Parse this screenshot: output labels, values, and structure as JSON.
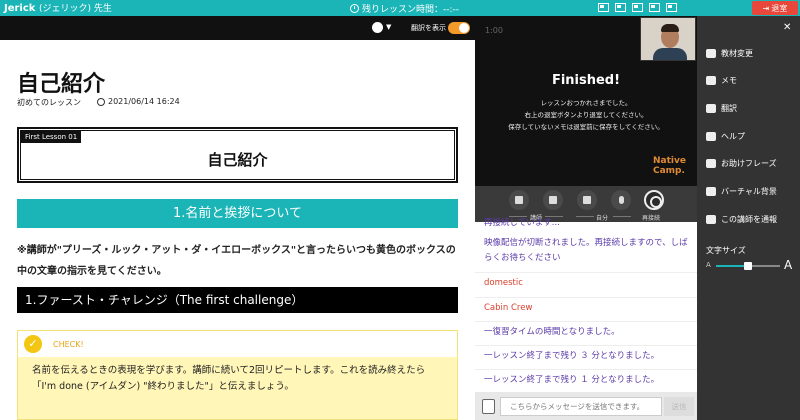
{
  "colors": {
    "accent": "#1bb5b8",
    "exit": "#e8473b",
    "toggle": "#f39a2a",
    "sidebar_bg": "#333333",
    "check_yellow": "#f3c614"
  },
  "topbar": {
    "teacher_name": "Jerick",
    "teacher_sub": "(ジェリック) 先生",
    "timer_label": "残りレッスン時間：--:--",
    "exit_label": "退室"
  },
  "material": {
    "translate_label": "翻訳を表示",
    "title": "自己紹介",
    "course": "初めてのレッスン",
    "date": "2021/06/14 16:24",
    "lesson_tag": "First Lesson 01",
    "lesson_heading": "自己紹介",
    "section1": "1.名前と挨拶について",
    "instruction": "※講師が\"プリーズ・ルック・アット・ダ・イエローボックス\"と言ったらいつも黄色のボックスの中の文章の指示を見てください。",
    "section2": "1.ファースト・チャレンジ（The first challenge）",
    "check_label": "CHECK!",
    "check_body_1": "名前を伝えるときの表現を学びます。講師に続いて2回リピートします。これを読み終えたら",
    "check_body_2": "「I'm done (アイムダン) \"終わりました\"」と伝えましょう。"
  },
  "video": {
    "clock": "1:00",
    "finished_title": "Finished!",
    "line1": "レッスンおつかれさまでした。",
    "line2": "右上の退室ボタンより退室してください。",
    "line3": "保存していないメモは退室前に保存をしてください。",
    "logo_line1": "Native",
    "logo_line2": "Camp.",
    "ctrl_teacher": "講師",
    "ctrl_self": "自分",
    "ctrl_reconnect": "再接続"
  },
  "chat": {
    "partial": "再接続しています...",
    "messages": [
      {
        "text": "映像配信が切断されました。再接続しますので、しばらくお待ちください",
        "color": "purple"
      },
      {
        "text": "domestic",
        "color": "red"
      },
      {
        "text": "Cabin Crew",
        "color": "red"
      },
      {
        "text": "一復習タイムの時間となりました。",
        "color": "purple"
      },
      {
        "text": "一レッスン終了まで残り ３ 分となりました。",
        "color": "purple"
      },
      {
        "text": "一レッスン終了まで残り １ 分となりました。",
        "color": "purple"
      }
    ],
    "input_placeholder": "こちらからメッセージを送信できます。",
    "send_label": "送信"
  },
  "sidebar": {
    "items": [
      {
        "label": "教材変更",
        "icon": "book-icon"
      },
      {
        "label": "メモ",
        "icon": "edit-icon"
      },
      {
        "label": "翻訳",
        "icon": "globe-icon"
      },
      {
        "label": "ヘルプ",
        "icon": "help-icon"
      },
      {
        "label": "お助けフレーズ",
        "icon": "chat-bubble-icon"
      },
      {
        "label": "バーチャル背景",
        "icon": "image-icon"
      },
      {
        "label": "この講師を通報",
        "icon": "flag-icon"
      }
    ],
    "font_size_label": "文字サイズ",
    "font_size_level": 0.5
  }
}
